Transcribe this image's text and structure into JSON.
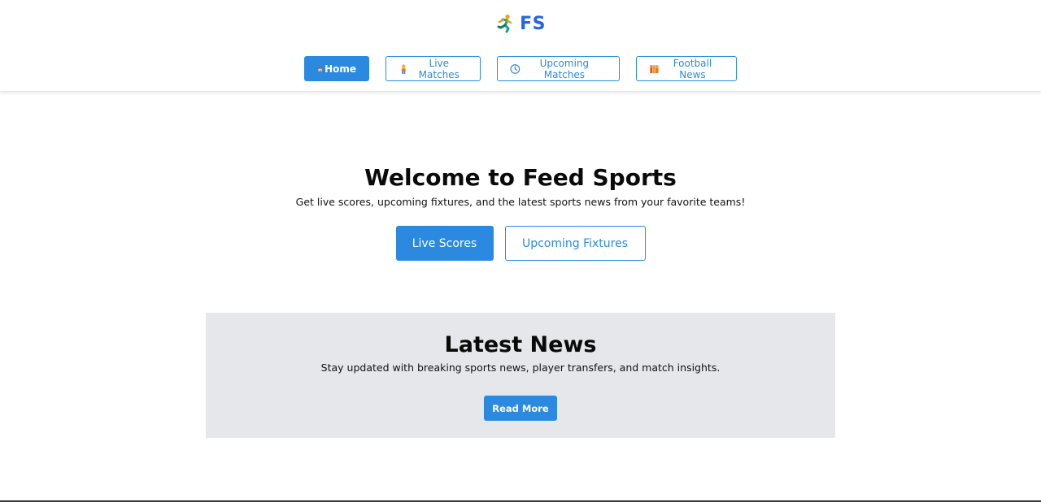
{
  "brand": {
    "name": "FS",
    "logo_icon": "runner-icon",
    "color": "#2563eb"
  },
  "nav": {
    "items": [
      {
        "label": "Home",
        "icon": "house-icon",
        "active": true
      },
      {
        "label": "Live Matches",
        "icon": "person-icon",
        "active": false
      },
      {
        "label": "Upcoming Matches",
        "icon": "clock-icon",
        "active": false
      },
      {
        "label": "Football News",
        "icon": "books-icon",
        "active": false
      }
    ]
  },
  "hero": {
    "title": "Welcome to Feed Sports",
    "subtitle": "Get live scores, upcoming fixtures, and the latest sports news from your favorite teams!",
    "primary_button": "Live Scores",
    "secondary_button": "Upcoming Fixtures"
  },
  "news": {
    "title": "Latest News",
    "subtitle": "Stay updated with breaking sports news, player transfers, and match insights.",
    "button": "Read More"
  },
  "colors": {
    "accent": "#2b8ae0",
    "section_bg": "#e5e7eb"
  }
}
